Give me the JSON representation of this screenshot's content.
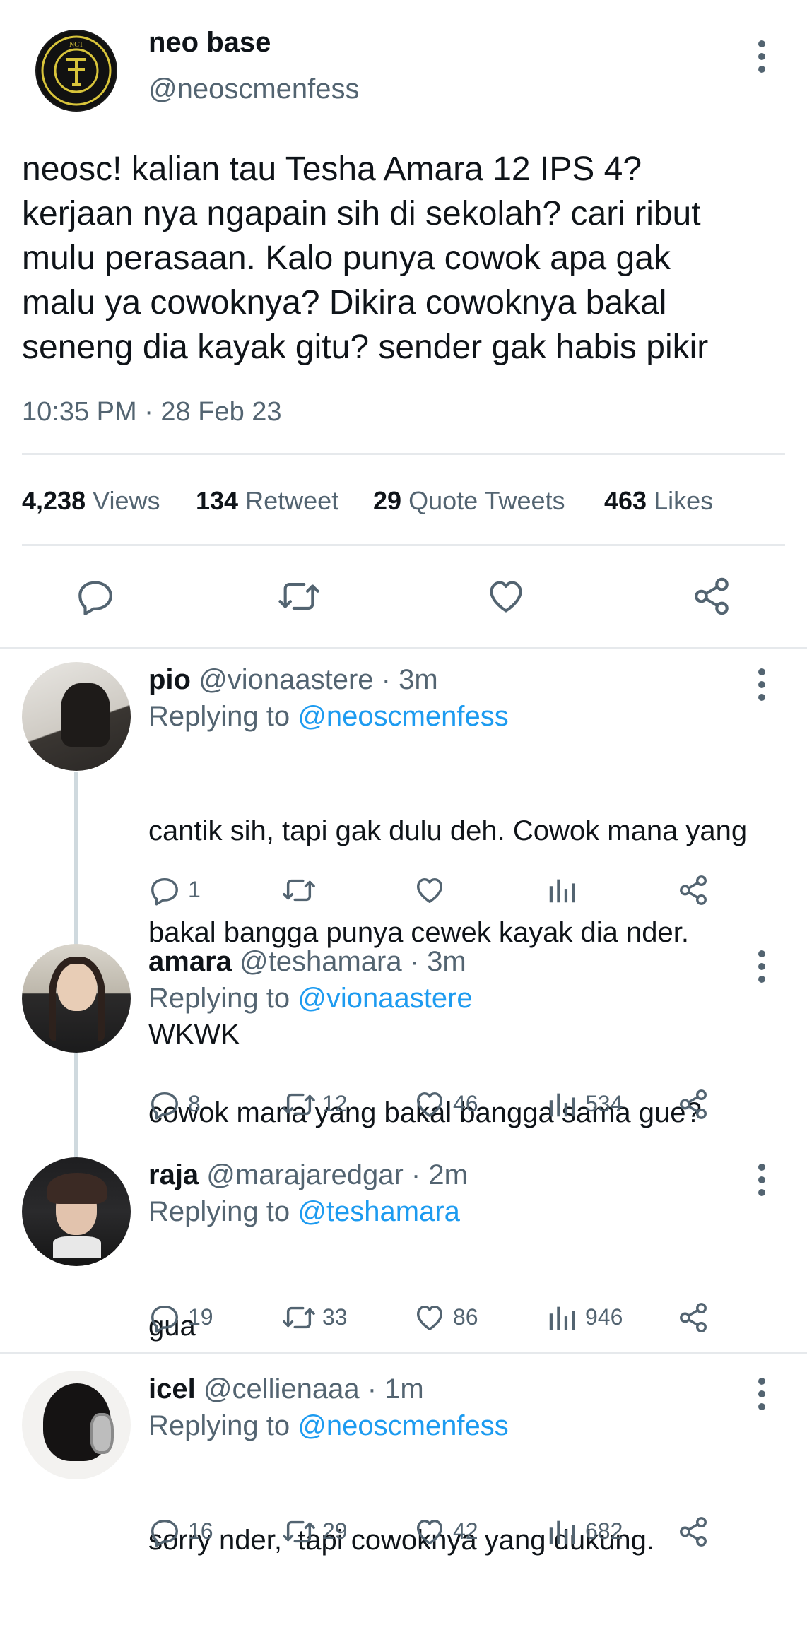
{
  "tweet": {
    "author_name": "neo base",
    "author_handle": "@neoscmenfess",
    "body_lines": [
      "neosc! kalian tau Tesha Amara 12 IPS 4?",
      "kerjaan nya ngapain sih di sekolah? cari ribut",
      "mulu perasaan. Kalo punya cowok apa gak",
      "malu ya cowoknya? Dikira cowoknya bakal",
      "seneng dia kayak gitu? sender gak habis pikir"
    ],
    "timestamp": "10:35 PM · 28 Feb 23",
    "stats": {
      "views_count": "4,238",
      "views_label": "Views",
      "retweets_count": "134",
      "retweets_label": "Retweet",
      "quotes_count": "29",
      "quotes_label": "Quote Tweets",
      "likes_count": "463",
      "likes_label": "Likes"
    },
    "logo_text": "NCT"
  },
  "replies": [
    {
      "name": "pio",
      "handle": "@vionaastere",
      "time": "· 3m",
      "replying_label": "Replying to",
      "replying_to": "@neoscmenfess",
      "body_lines": [
        "cantik sih, tapi gak dulu deh. Cowok mana yang",
        "bakal bangga punya cewek kayak dia nder.",
        "WKWK"
      ],
      "replies": "1",
      "retweets": "",
      "likes": "",
      "views": ""
    },
    {
      "name": "amara",
      "handle": "@teshamara",
      "time": "· 3m",
      "replying_label": "Replying to",
      "replying_to": "@vionaastere",
      "body_lines": [
        "cowok mana yang bakal bangga sama gue?"
      ],
      "replies": "8",
      "retweets": "12",
      "likes": "46",
      "views": "534"
    },
    {
      "name": "raja",
      "handle": "@marajaredgar",
      "time": "· 2m",
      "replying_label": "Replying to",
      "replying_to": "@teshamara",
      "body_lines": [
        "gua"
      ],
      "replies": "19",
      "retweets": "33",
      "likes": "86",
      "views": "946"
    },
    {
      "name": "icel",
      "handle": "@cellienaaa",
      "time": "· 1m",
      "replying_label": "Replying to",
      "replying_to": "@neoscmenfess",
      "body_lines": [
        "sorry nder,  tapi cowoknya yang dukung."
      ],
      "replies": "16",
      "retweets": "29",
      "likes": "42",
      "views": "682"
    }
  ],
  "colors": {
    "text": "#0f1419",
    "secondary": "#536471",
    "link": "#1d9bf0",
    "divider": "#e6e9ec"
  }
}
